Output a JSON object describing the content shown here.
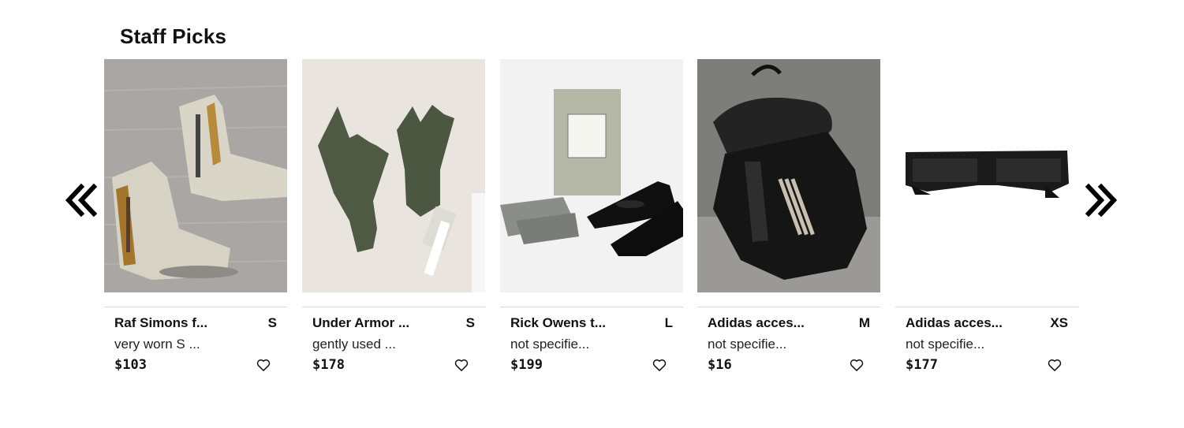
{
  "section": {
    "title": "Staff Picks"
  },
  "nav": {
    "prev_icon": "double-chevron-left-icon",
    "next_icon": "double-chevron-right-icon"
  },
  "icons": {
    "favorite": "heart-outline-icon"
  },
  "items": [
    {
      "title": "Raf Simons f...",
      "size": "S",
      "condition": "very worn S ...",
      "price": "$103",
      "image": "high-top-sneakers-photo"
    },
    {
      "title": "Under Armor ...",
      "size": "S",
      "condition": "gently used ...",
      "price": "$178",
      "image": "fingerless-gloves-photo"
    },
    {
      "title": "Rick Owens t...",
      "size": "L",
      "condition": "not specifie...",
      "price": "$199",
      "image": "dress-shoes-with-box-photo"
    },
    {
      "title": "Adidas acces...",
      "size": "M",
      "condition": "not specifie...",
      "price": "$16",
      "image": "leather-backpack-photo"
    },
    {
      "title": "Adidas acces...",
      "size": "XS",
      "condition": "not specifie...",
      "price": "$177",
      "image": "sunglasses-photo"
    }
  ]
}
